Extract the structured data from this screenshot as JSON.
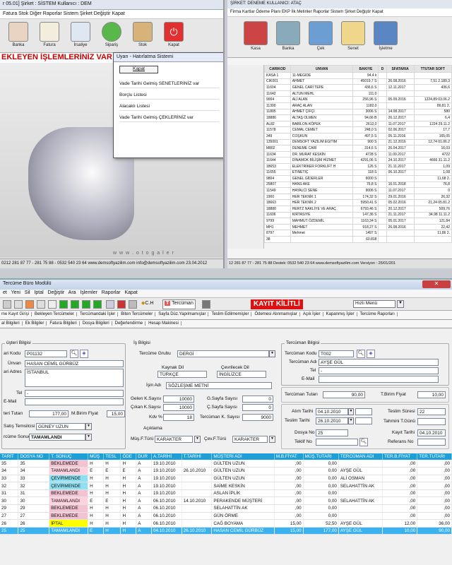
{
  "panel_a": {
    "title": "r 05.01]      Şirket : SİSTEM       Kullanıcı : DEM",
    "menu": "Fatura  Stok  Diğer  Raporlar  Sistem  Şirket Değiştir  Kapat",
    "toolbar": [
      "Banka",
      "Fatura",
      "İrsaliye",
      "Sipariş",
      "Stok",
      "Kapat"
    ],
    "banner": "EKLEYEN İŞLEMLERİNİZ VAR",
    "dialog": {
      "title": "Uyarı - Hatırlatma Sistemi",
      "close_label": "Kapat",
      "items": [
        "Vade Tarihi Gelmiş SENETLERİNİZ var",
        "Borçlu Listesi",
        "Alacaklı Listesi",
        "Vade Tarihi Gelmiş ÇEKLERİNİZ var"
      ]
    },
    "watermark": "w w w . o t o g a l e r",
    "status": "0212 281 87 77 - 281 75 88 - 0532 540 23 64  www.demsoftyazilim.com  info@demsoftyazilim.com  23.04.2012"
  },
  "panel_b": {
    "title": "ŞİRKET: DENEME      KULLANICI: ATAÇ",
    "menu": "Firma  Kartlar  Ödeme Planı  EKP  İlk Metinler  Raporlar  Sistem  Şirket Değiştir  Kapat",
    "toolbar": [
      "Kasa",
      "Banka",
      "Çek",
      "Senet",
      "İşletme"
    ],
    "columns": [
      "CARIKOD",
      "UNVAN",
      "BAKIYE",
      "D",
      "SFATARIA",
      "TTUTAR SOFT"
    ],
    "rows": [
      [
        "KASA 1",
        "11-MEGIDE",
        "94,4 k",
        "",
        "",
        ""
      ],
      [
        "CIK001",
        "AHMET",
        "45019,7 S",
        "",
        "26.08.2016",
        "7,51 2.189,3"
      ],
      [
        "11604",
        "GENEL CARİ TEPE",
        "436,6 S",
        "",
        "12.11.2017",
        "436,6"
      ],
      [
        "11642",
        "ALTUN MEHL",
        "111,0",
        "",
        "",
        ""
      ],
      [
        "9004",
        "ALİ ALAN",
        "256,96 S",
        "",
        "05.09.2016",
        "1224,89 03.06.2"
      ],
      [
        "11300",
        "ARAÇ ALAN",
        "1182,0",
        "",
        "",
        "86,81 2."
      ],
      [
        "11805",
        "AHMET ÇİFÇİ",
        "3006 S",
        "",
        "14.08.2017",
        "580"
      ],
      [
        "18886",
        "ALTAŞ OLMEN",
        "94,66 B",
        "",
        "26.12.2017",
        "6,4"
      ],
      [
        "AL82",
        "BABİLON KÖPEK",
        "2612,0",
        "",
        "11.07.2017",
        "1224 29.11.2"
      ],
      [
        "11578",
        "CEMAL CEMET",
        "248,0 S",
        "",
        "02.06.2017",
        "17,7"
      ],
      [
        "349",
        "COŞKUN",
        "497,5 S",
        "",
        "05.11.2016",
        "165,05"
      ],
      [
        "135001",
        "DEMSOFT YAZILIM EĞİTİM",
        "900 S",
        "",
        "21.12.2016",
        "12,74 01.06.2"
      ],
      [
        "M802",
        "DENEME CARİ",
        "314,6 S",
        "",
        "26.04.2017",
        "16,03"
      ],
      [
        "11634",
        "DR. MURAT KESKİN",
        "4728 S",
        "",
        "11.09.2017",
        "4722"
      ],
      [
        "11644",
        "DİNAMOK BİLİŞİM HİZMET",
        "4291,06 S",
        "",
        "24.10.2017",
        "4666 31.11.2"
      ],
      [
        "18653",
        "ELEKTRİKER FORKLİFT H",
        "126 S",
        "",
        "21.11.2017",
        "1,09"
      ],
      [
        "11655",
        "ETİNETİÇ",
        "118 S",
        "",
        "06.10.2017",
        "1,08"
      ],
      [
        "9804",
        "GENEL GİDERLER",
        "6000 S",
        "",
        "",
        "11,68 2."
      ],
      [
        "25807",
        "HANS AKE",
        "76,8 S",
        "",
        "16.01.2018",
        "76,8"
      ],
      [
        "11549",
        "HAYALCİ SENE",
        "9006 S",
        "",
        "11.07.2017",
        "0"
      ],
      [
        "1900",
        "HER TEKNİK 1",
        "174,32 S",
        "",
        "29.01.2016",
        "26,32"
      ],
      [
        "18663",
        "HER TEKNİK 2",
        "5950,41 S",
        "",
        "05.02.2016",
        "21,24 05.81.2"
      ],
      [
        "18880",
        "HERTZ NAKLİYE VE ARAÇ",
        "6793,46 S",
        "",
        "20.12.2017",
        "509,76"
      ],
      [
        "11606",
        "KİRTASİYE",
        "147,36 S",
        "",
        "21.11.2017",
        "34,98 11.11.2"
      ],
      [
        "9799",
        "MAHMUT ÖZDEMİL",
        "1163,34 S",
        "",
        "05.01.2017",
        "121,84"
      ],
      [
        "MH1",
        "MEHMET",
        "918,27 S",
        "",
        "26.08.2016",
        "22,42"
      ],
      [
        "8797",
        "Mehmet",
        "1497 S",
        "",
        "",
        "11,86 2."
      ]
    ],
    "footer_count": "38",
    "footer_total": "60.818",
    "status": "12 281 87 77 - 281 75 88     Destek: 0532 540 23 64   www.demsoftyazilim.com        Versiyon : 25/01/201"
  },
  "panel_c": {
    "title": "Tercüme Büro Modülü",
    "menu": [
      "et",
      "Yeni",
      "Sil",
      "İptal",
      "Değiştir",
      "Ara",
      "İşlemler",
      "Raporlar",
      "Kapat"
    ],
    "toolbar_ch": "C.H",
    "toolbar_tercuman": "Tercüman",
    "locked": "KAYIT KİLİTLİ",
    "quick_menu": "Hızlı Menü",
    "tabs": [
      "me Kayıt Girişi",
      "Bekleyen Tercümeler",
      "Tercümandaki İşler",
      "Biten Tercümeler",
      "Sayfa Düz.Yapılmamışlar",
      "Teslim Edilmemişler",
      "Ödemesi Alınmamışlar",
      "Açık İşler",
      "Kapanmış İşler",
      "Tercüme Raporları"
    ],
    "subtabs": [
      "al Bilgileri",
      "Ek Bilgiler",
      "Fatura Bilgileri",
      "Dosya Bilgileri",
      "Değerlendirme",
      "Hesap Makinesi"
    ],
    "musteri": {
      "legend": "üşteri Bilgisi",
      "kod_label": "ari Kodu",
      "kod": "P01132",
      "unvan_label": "Ünvan",
      "unvan": "HASAN CEMİL GÜRBÜZ",
      "adres_label": "ari Adres",
      "adres": "İSTANBUL",
      "tel_label": "Tel",
      "tel": "-",
      "email_label": "E-Mail",
      "email": "",
      "tutar_label": "teri Tutarı",
      "tutar": "177,00",
      "birim_label": "M.Birim Fiyat",
      "birim": "15,00",
      "temsilci_label": "Satış Temsilcisi",
      "temsilci": "GÜNEY UZUN",
      "sonuc_label": "rcüme Sonucu",
      "sonuc": "TAMAMLANDI"
    },
    "is": {
      "legend": "İş Bilgisi",
      "grubu_label": "Tercüme Grubu",
      "grubu": "DERGİ",
      "kaynak_label": "Kaynak Dil",
      "kaynak": "TÜRKÇE",
      "ceviri_label": "Çevrilecek Dil",
      "ceviri": "İNGİLİZCE",
      "adi_label": "İşin Adı",
      "adi": "SÖZLEŞME METNİ",
      "gelen_label": "Gelen K.Sayısı",
      "gelen": "10000",
      "gsayfa_label": "G.Sayfa Sayısı",
      "gsayfa": "0",
      "cikan_label": "Çıkan K.Sayısı",
      "cikan": "10000",
      "csayfa_label": "Ç.Sayfa Sayısı",
      "csayfa": "0",
      "kdv_label": "Kdv %",
      "kdv": "18",
      "tks_label": "Tercüman K. Sayısı",
      "tks": "9000",
      "aciklama_label": "Açıklama",
      "mus_label": "Müş.F.Türü",
      "mus": "KARAKTER",
      "cev_label": "Çev.F.Türü",
      "cev": "KARAKTER"
    },
    "tercuman": {
      "legend": "Tercüman Bilgisi",
      "kod_label": "Tercüman Kodu",
      "kod": "T002",
      "adi_label": "Tercüman Adı",
      "adi": "AYŞE GÜL",
      "tel_label": "Tel",
      "tel": "-",
      "email_label": "E-Mail",
      "email": "",
      "tutar_label": "Tercüman Tutarı",
      "tutar": "90,00",
      "birim_label": "T.Birim Fiyat",
      "birim": "10,00",
      "alim_label": "Alım Tarihi",
      "alim": "04.10.2010",
      "sure_label": "Teslim Süresi",
      "sure": "22",
      "teslim_label": "Teslim Tarihi",
      "teslim": "26.10.2010",
      "tahmini_label": "Tahmini T.Günü",
      "dosya_label": "Dosya No",
      "dosya": "25",
      "kayit_label": "Kayıt Tarihi",
      "kayit": "04.10.2010",
      "teklif_label": "Teklif No",
      "ref_label": "Referans No"
    },
    "grid_columns": [
      "TARİT",
      "DOSYA NO",
      "T. SONUÇ",
      "MÜŞ",
      "TESL",
      "ÖDE",
      "DUR",
      "A.TARİHİ",
      "T.TARİHİ",
      "MÜŞTERİ ADI",
      "M.B.FİYAT",
      "MÜŞ.TUTARI",
      "TERCÜMAN ADI",
      "TER.B.FİYAT",
      "TER.TUTARI"
    ],
    "grid_rows": [
      [
        "35",
        "35",
        "BEKLEMEDE",
        "H",
        "H",
        "H",
        "A",
        "19.10.2010",
        "",
        "GÜLTEN UZUN",
        ",00",
        "0,00",
        "",
        ",00",
        ",00"
      ],
      [
        "34",
        "34",
        "TAMAMLANDI",
        "E",
        "E",
        "E",
        "A",
        "19.10.2010",
        "26.10.2010",
        "GÜLTEN UZUN",
        ",00",
        "0,00",
        "AYŞE GÜL",
        ",00",
        ",00"
      ],
      [
        "33",
        "33",
        "ÇEVİRMENDE",
        "H",
        "H",
        "H",
        "A",
        "19.10.2010",
        "",
        "GÜLTEN UZUN",
        ",00",
        "0,00",
        "ALİ OSMAN",
        ",00",
        ",00"
      ],
      [
        "32",
        "32",
        "ÇEVİRMENDE",
        "H",
        "H",
        "H",
        "A",
        "19.10.2010",
        "",
        "SAİME KESKİN",
        ",00",
        "0,00",
        "SELAHATTİN AK",
        ",00",
        ",00"
      ],
      [
        "31",
        "31",
        "BEKLEMEDE",
        "H",
        "H",
        "H",
        "A",
        "19.10.2010",
        "",
        "ASLAN İPLİK",
        ",00",
        "0,00",
        "",
        ",00",
        ",00"
      ],
      [
        "30",
        "30",
        "TAMAMLANDI",
        "E",
        "E",
        "H",
        "A",
        "06.10.2010",
        "14.10.2010",
        "PERAKENDE MÜŞTERİ",
        ",00",
        "0,00",
        "SELAHATTİN AK",
        ",00",
        ",00"
      ],
      [
        "29",
        "29",
        "BEKLEMEDE",
        "H",
        "H",
        "H",
        "A",
        "06.10.2010",
        "",
        "SELAHATTİN AK",
        ",00",
        "0,00",
        "",
        ",00",
        ",00"
      ],
      [
        "27",
        "27",
        "BEKLEMEDE",
        "H",
        "H",
        "H",
        "A",
        "06.10.2010",
        "",
        "GÜN ÖRME",
        ",00",
        "0,00",
        "",
        ",00",
        ",00"
      ],
      [
        "26",
        "26",
        "İPTAL",
        "H",
        "H",
        "H",
        "A",
        "06.10.2010",
        "",
        "CAĞ BOYAMA",
        "15,00",
        "52,50",
        "AYŞE GÜL",
        "12,00",
        "36,00"
      ],
      [
        "25",
        "25",
        "TAMAMLANDI",
        "E",
        "H",
        "H",
        "A",
        "04.10.2010",
        "26.10.2010",
        "HASAN CEMİL GÜRBÜZ",
        "15,00",
        "177,00",
        "AYŞE GÜL",
        "10,00",
        "90,00"
      ]
    ],
    "colors": {
      "header": "#1e9fd8",
      "selected": "#3bb2f0",
      "locked": "#e01010"
    }
  }
}
